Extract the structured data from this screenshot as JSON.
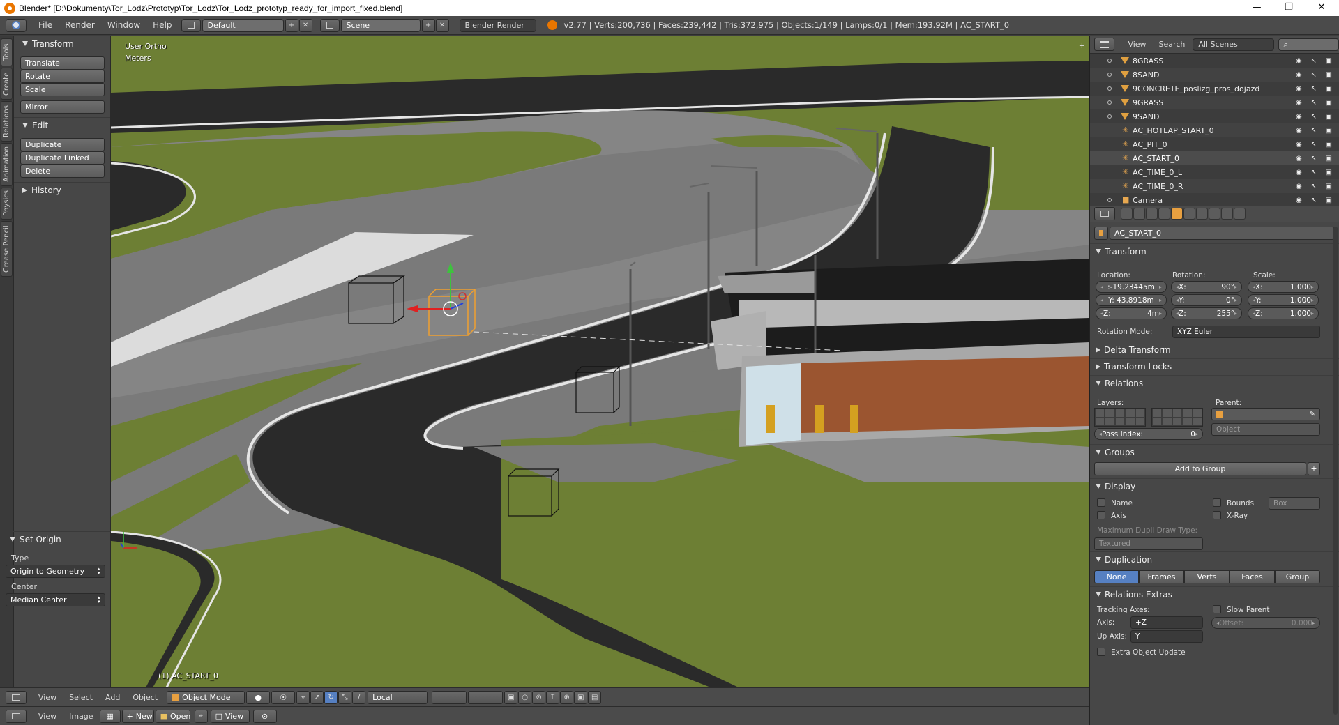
{
  "titlebar": {
    "title": "Blender* [D:\\Dokumenty\\Tor_Lodz\\Prototyp\\Tor_Lodz\\Tor_Lodz_prototyp_ready_for_import_fixed.blend]",
    "minimize": "—",
    "restore": "❐",
    "close": "✕"
  },
  "infobar": {
    "menus": [
      "File",
      "Render",
      "Window",
      "Help"
    ],
    "layout": "Default",
    "scene": "Scene",
    "engine": "Blender Render",
    "stats": "v2.77 | Verts:200,736 | Faces:239,442 | Tris:372,975 | Objects:1/149 | Lamps:0/1 | Mem:193.92M | AC_START_0"
  },
  "vtabs": [
    "Tools",
    "Create",
    "Relations",
    "Animation",
    "Physics",
    "Grease Pencil"
  ],
  "toolshelf": {
    "transform": {
      "title": "Transform",
      "buttons": [
        "Translate",
        "Rotate",
        "Scale"
      ],
      "mirror": "Mirror"
    },
    "edit": {
      "title": "Edit",
      "buttons": [
        "Duplicate",
        "Duplicate Linked",
        "Delete"
      ]
    },
    "history": {
      "title": "History"
    },
    "set_origin": {
      "title": "Set Origin",
      "type_label": "Type",
      "type_value": "Origin to Geometry",
      "center_label": "Center",
      "center_value": "Median Center"
    }
  },
  "viewport": {
    "view_name": "User Ortho",
    "units": "Meters",
    "active": "(1) AC_START_0"
  },
  "view3d_header": {
    "menus": [
      "View",
      "Select",
      "Add",
      "Object"
    ],
    "mode": "Object Mode",
    "orientation": "Local"
  },
  "image_header": {
    "menus": [
      "View",
      "Image"
    ],
    "new": "New",
    "open": "Open",
    "view": "View"
  },
  "outliner": {
    "header": {
      "view": "View",
      "search": "Search",
      "scenes": "All Scenes"
    },
    "rows": [
      {
        "name": "8GRASS",
        "type": "mesh"
      },
      {
        "name": "8SAND",
        "type": "mesh"
      },
      {
        "name": "9CONCRETE_poslizg_pros_dojazd",
        "type": "mesh"
      },
      {
        "name": "9GRASS",
        "type": "mesh"
      },
      {
        "name": "9SAND",
        "type": "mesh"
      },
      {
        "name": "AC_HOTLAP_START_0",
        "type": "empty"
      },
      {
        "name": "AC_PIT_0",
        "type": "empty"
      },
      {
        "name": "AC_START_0",
        "type": "empty"
      },
      {
        "name": "AC_TIME_0_L",
        "type": "empty"
      },
      {
        "name": "AC_TIME_0_R",
        "type": "empty"
      },
      {
        "name": "Camera",
        "type": "camera"
      }
    ]
  },
  "properties": {
    "object_name": "AC_START_0",
    "transform": {
      "title": "Transform",
      "location_label": "Location:",
      "rotation_label": "Rotation:",
      "scale_label": "Scale:",
      "location": [
        ":-19.23445m",
        "Y: 43.8918m",
        "Z:",
        "4m"
      ],
      "loc_x": ":-19.23445m",
      "loc_y": "Y: 43.8918m",
      "loc_z_label": "Z:",
      "loc_z": "4m",
      "rot_x_label": "X:",
      "rot_x": "90°",
      "rot_y_label": "Y:",
      "rot_y": "0°",
      "rot_z_label": "Z:",
      "rot_z": "255°",
      "scale_x_label": "X:",
      "scale_x": "1.000",
      "scale_y_label": "Y:",
      "scale_y": "1.000",
      "scale_z_label": "Z:",
      "scale_z": "1.000",
      "rotation_mode_label": "Rotation Mode:",
      "rotation_mode": "XYZ Euler"
    },
    "delta_transform": "Delta Transform",
    "transform_locks": "Transform Locks",
    "relations": {
      "title": "Relations",
      "layers_label": "Layers:",
      "parent_label": "Parent:",
      "parent_type": "Object",
      "pass_index_label": "Pass Index:",
      "pass_index": "0"
    },
    "groups": {
      "title": "Groups",
      "add": "Add to Group"
    },
    "display": {
      "title": "Display",
      "name": "Name",
      "axis": "Axis",
      "bounds": "Bounds",
      "bounds_type": "Box",
      "xray": "X-Ray",
      "max_dupli_label": "Maximum Dupli Draw Type:",
      "max_dupli": "Textured"
    },
    "duplication": {
      "title": "Duplication",
      "options": [
        "None",
        "Frames",
        "Verts",
        "Faces",
        "Group"
      ]
    },
    "relations_extras": {
      "title": "Relations Extras",
      "tracking_axes": "Tracking Axes:",
      "slow_parent": "Slow Parent",
      "axis_label": "Axis:",
      "axis": "+Z",
      "offset_label": "Offset:",
      "offset": "0.000",
      "up_axis_label": "Up Axis:",
      "up_axis": "Y",
      "extra_update": "Extra Object Update"
    }
  },
  "colors": {
    "grass": "#6d7f34",
    "asphalt": "#2b2b2b",
    "concrete": "#7a7a7a",
    "selection": "#f0a030",
    "active_blue": "#5680c2"
  }
}
